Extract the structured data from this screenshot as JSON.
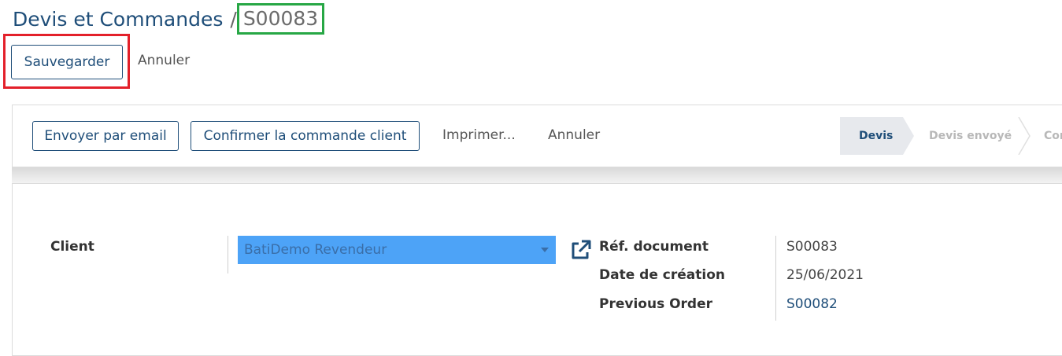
{
  "breadcrumb": {
    "parent": "Devis et Commandes",
    "separator": "/",
    "current": "S00083"
  },
  "actions": {
    "save_label": "Sauvegarder",
    "cancel_label": "Annuler"
  },
  "statusbar": {
    "buttons": [
      "Envoyer par email",
      "Confirmer la commande client"
    ],
    "links": [
      "Imprimer...",
      "Annuler"
    ],
    "stages": [
      {
        "label": "Devis",
        "active": true
      },
      {
        "label": "Devis envoyé",
        "active": false
      },
      {
        "label": "Con",
        "active": false
      }
    ]
  },
  "form": {
    "client_label": "Client",
    "client_value": "BatiDemo Revendeur",
    "fields": [
      {
        "label": "Réf. document",
        "value": "S00083",
        "link": false
      },
      {
        "label": "Date de création",
        "value": "25/06/2021",
        "link": false
      },
      {
        "label": "Previous Order",
        "value": "S00082",
        "link": true
      }
    ]
  },
  "colors": {
    "primary": "#1f4e79",
    "highlight_red": "#e3202a",
    "highlight_green": "#27a745",
    "select_bg": "#4da3f7",
    "stage_active_bg": "#e7e9ed"
  },
  "icons": {
    "external_link": "external-link-icon",
    "dropdown": "chevron-down-icon"
  }
}
